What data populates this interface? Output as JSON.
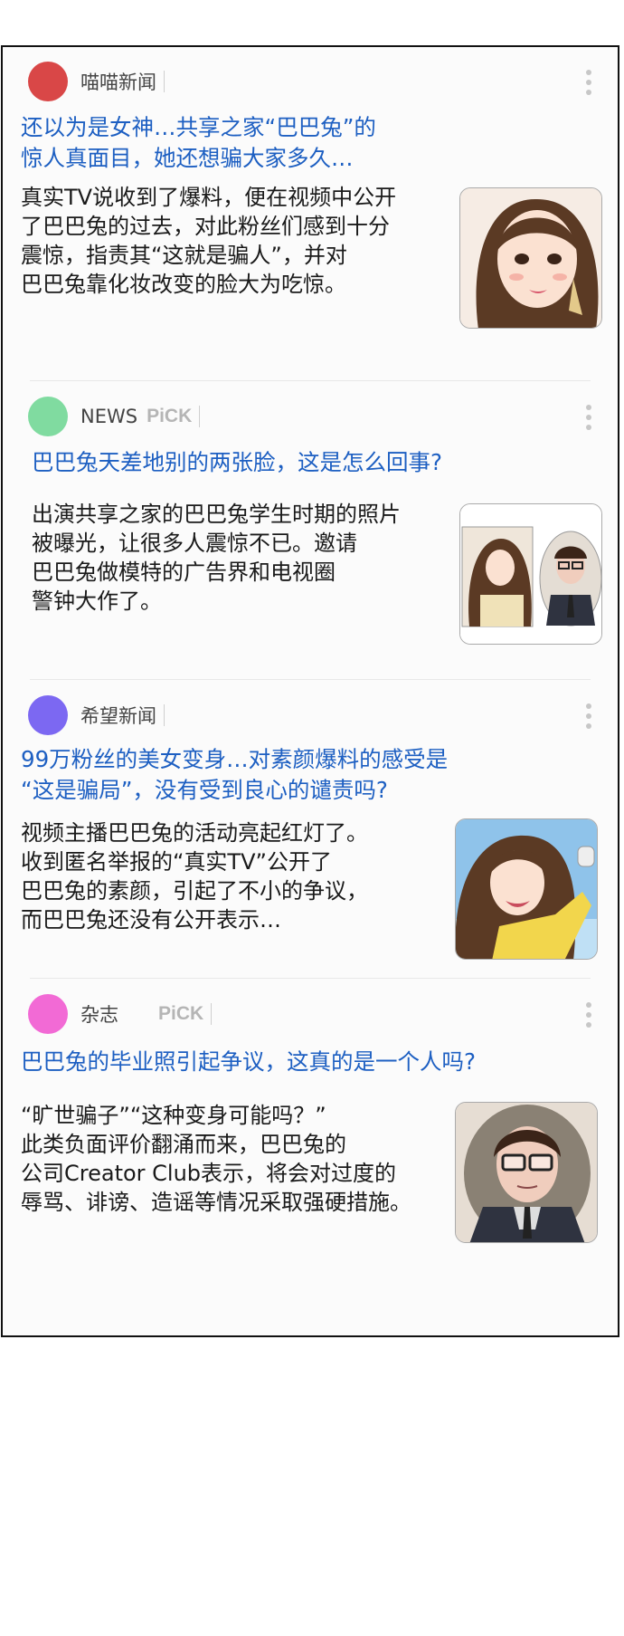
{
  "articles": [
    {
      "source": "喵喵新闻",
      "pick": "",
      "avatar_color": "#d94747",
      "headline_1": "还以为是女神…共享之家“巴巴兔”的",
      "headline_2": "惊人真面目，她还想骗大家多久…",
      "body": [
        "真实TV说收到了爆料，便在视频中公开",
        "了巴巴兔的过去，对此粉丝们感到十分",
        "震惊，指责其“这就是骗人”，并对",
        "巴巴兔靠化妆改变的脸大为吃惊。"
      ],
      "thumb_icon": "woman-portrait-image"
    },
    {
      "source": "NEWS",
      "pick": "PiCK",
      "avatar_color": "#80dba0",
      "headline_1": "巴巴兔天差地别的两张脸，这是怎么回事?",
      "headline_2": "",
      "body": [
        "出演共享之家的巴巴兔学生时期的照片",
        "被曝光，让很多人震惊不已。邀请",
        "巴巴兔做模特的广告界和电视圈",
        "警钟大作了。"
      ],
      "thumb_icon": "two-photos-image"
    },
    {
      "source": "希望新闻",
      "pick": "",
      "avatar_color": "#7c68f2",
      "headline_1": "99万粉丝的美女变身…对素颜爆料的感受是",
      "headline_2": "“这是骗局”，没有受到良心的谴责吗?",
      "body": [
        "视频主播巴巴兔的活动亮起红灯了。",
        "收到匿名举报的“真实TV”公开了",
        "巴巴兔的素颜，引起了不小的争议，",
        "而巴巴兔还没有公开表示…"
      ],
      "thumb_icon": "golfer-image"
    },
    {
      "source": "杂志",
      "pick": "PiCK",
      "avatar_color": "#f26ad5",
      "headline_1": "巴巴兔的毕业照引起争议，这真的是一个人吗?",
      "headline_2": "",
      "body": [
        "“旷世骗子”“这种变身可能吗？”",
        "此类负面评价翻涌而来，巴巴兔的",
        "公司Creator Club表示，将会对过度的",
        "辱骂、诽谤、造谣等情况采取强硬措施。"
      ],
      "thumb_icon": "glasses-man-image"
    }
  ]
}
